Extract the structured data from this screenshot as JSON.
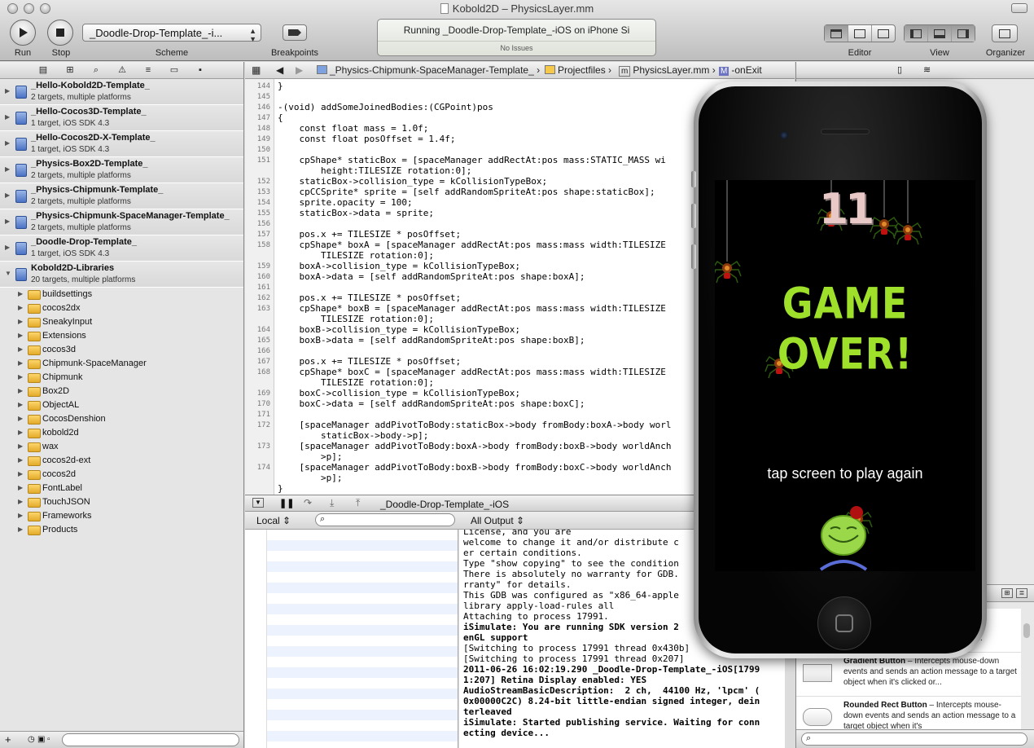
{
  "window": {
    "title": "Kobold2D – PhysicsLayer.mm"
  },
  "toolbar": {
    "run_label": "Run",
    "stop_label": "Stop",
    "scheme_value": "_Doodle-Drop-Template_-i...",
    "scheme_label": "Scheme",
    "breakpoints_label": "Breakpoints",
    "status_main": "Running _Doodle-Drop-Template_-iOS on iPhone Si",
    "status_sub": "No Issues",
    "editor_label": "Editor",
    "view_label": "View",
    "organizer_label": "Organizer"
  },
  "navigator": {
    "projects": [
      {
        "name": "_Hello-Kobold2D-Template_",
        "sub": "2 targets, multiple platforms"
      },
      {
        "name": "_Hello-Cocos3D-Template_",
        "sub": "1 target, iOS SDK 4.3"
      },
      {
        "name": "_Hello-Cocos2D-X-Template_",
        "sub": "1 target, iOS SDK 4.3"
      },
      {
        "name": "_Physics-Box2D-Template_",
        "sub": "2 targets, multiple platforms"
      },
      {
        "name": "_Physics-Chipmunk-Template_",
        "sub": "2 targets, multiple platforms"
      },
      {
        "name": "_Physics-Chipmunk-SpaceManager-Template_",
        "sub": "2 targets, multiple platforms"
      },
      {
        "name": "_Doodle-Drop-Template_",
        "sub": "1 target, iOS SDK 4.3"
      },
      {
        "name": "Kobold2D-Libraries",
        "sub": "20 targets, multiple platforms"
      }
    ],
    "groups": [
      "buildsettings",
      "cocos2dx",
      "SneakyInput",
      "Extensions",
      "cocos3d",
      "Chipmunk-SpaceManager",
      "Chipmunk",
      "Box2D",
      "ObjectAL",
      "CocosDenshion",
      "kobold2d",
      "wax",
      "cocos2d-ext",
      "cocos2d",
      "FontLabel",
      "TouchJSON",
      "Frameworks",
      "Products"
    ]
  },
  "jumpbar": {
    "project": "_Physics-Chipmunk-SpaceManager-Template_",
    "folder": "Projectfiles",
    "file": "PhysicsLayer.mm",
    "method": "-onExit",
    "method_badge": "M",
    "file_badge": "m"
  },
  "code": {
    "line_numbers": [
      "144",
      "145",
      "146",
      "147",
      "148",
      "149",
      "150",
      "151",
      "",
      "152",
      "153",
      "154",
      "155",
      "156",
      "157",
      "158",
      "",
      "159",
      "160",
      "161",
      "162",
      "163",
      "",
      "164",
      "165",
      "166",
      "167",
      "168",
      "",
      "169",
      "170",
      "171",
      "172",
      "",
      "173",
      "",
      "174",
      "",
      ""
    ],
    "lines": [
      "}",
      "",
      "-(void) addSomeJoinedBodies:(CGPoint)pos",
      "{",
      "    const float mass = 1.0f;",
      "    const float posOffset = 1.4f;",
      "",
      "    cpShape* staticBox = [spaceManager addRectAt:pos mass:STATIC_MASS wi",
      "        height:TILESIZE rotation:0];",
      "    staticBox->collision_type = kCollisionTypeBox;",
      "    cpCCSprite* sprite = [self addRandomSpriteAt:pos shape:staticBox];",
      "    sprite.opacity = 100;",
      "    staticBox->data = sprite;",
      "",
      "    pos.x += TILESIZE * posOffset;",
      "    cpShape* boxA = [spaceManager addRectAt:pos mass:mass width:TILESIZE",
      "        TILESIZE rotation:0];",
      "    boxA->collision_type = kCollisionTypeBox;",
      "    boxA->data = [self addRandomSpriteAt:pos shape:boxA];",
      "",
      "    pos.x += TILESIZE * posOffset;",
      "    cpShape* boxB = [spaceManager addRectAt:pos mass:mass width:TILESIZE",
      "        TILESIZE rotation:0];",
      "    boxB->collision_type = kCollisionTypeBox;",
      "    boxB->data = [self addRandomSpriteAt:pos shape:boxB];",
      "",
      "    pos.x += TILESIZE * posOffset;",
      "    cpShape* boxC = [spaceManager addRectAt:pos mass:mass width:TILESIZE",
      "        TILESIZE rotation:0];",
      "    boxC->collision_type = kCollisionTypeBox;",
      "    boxC->data = [self addRandomSpriteAt:pos shape:boxC];",
      "",
      "    [spaceManager addPivotToBody:staticBox->body fromBody:boxA->body worl",
      "        staticBox->body->p];",
      "    [spaceManager addPivotToBody:boxA->body fromBody:boxB->body worldAnch",
      "        >p];",
      "    [spaceManager addPivotToBody:boxB->body fromBody:boxC->body worldAnch",
      "        >p];",
      "}"
    ]
  },
  "debug": {
    "target_label": "_Doodle-Drop-Template_-iOS",
    "local_label": "Local",
    "all_output_label": "All Output",
    "console_lines": [
      {
        "t": "License, and you are",
        "b": false
      },
      {
        "t": "welcome to change it and/or distribute c",
        "b": false
      },
      {
        "t": "er certain conditions.",
        "b": false
      },
      {
        "t": "Type \"show copying\" to see the condition",
        "b": false
      },
      {
        "t": "There is absolutely no warranty for GDB.",
        "b": false
      },
      {
        "t": "rranty\" for details.",
        "b": false
      },
      {
        "t": "This GDB was configured as \"x86_64-apple",
        "b": false
      },
      {
        "t": "library apply-load-rules all",
        "b": false
      },
      {
        "t": "Attaching to process 17991.",
        "b": false
      },
      {
        "t": "iSimulate: You are running SDK version 2",
        "b": true
      },
      {
        "t": "enGL support",
        "b": true
      },
      {
        "t": "[Switching to process 17991 thread 0x430b]",
        "b": false
      },
      {
        "t": "[Switching to process 17991 thread 0x207]",
        "b": false
      },
      {
        "t": "2011-06-26 16:02:19.290 _Doodle-Drop-Template_-iOS[1799",
        "b": true
      },
      {
        "t": "1:207] Retina Display enabled: YES",
        "b": true
      },
      {
        "t": "AudioStreamBasicDescription:  2 ch,  44100 Hz, 'lpcm' (",
        "b": true
      },
      {
        "t": "0x00000C2C) 8.24-bit little-endian signed integer, dein",
        "b": true
      },
      {
        "t": "terleaved",
        "b": true
      },
      {
        "t": "iSimulate: Started publishing service. Waiting for conn",
        "b": true
      },
      {
        "t": "ecting device...",
        "b": true
      }
    ]
  },
  "library": {
    "items": [
      {
        "title": "",
        "desc": "own\ne to a\nressed."
      },
      {
        "title": "Gradient Button",
        "desc": " – Intercepts mouse-down events and sends an action message to a target object when it's clicked or..."
      },
      {
        "title": "Rounded Rect Button",
        "desc": " – Intercepts mouse-down events and sends an action message to a target object when it's"
      }
    ]
  },
  "game": {
    "score": "11",
    "game_over": "GAME OVER!",
    "tap_text": "tap screen to play again",
    "colors": {
      "game_over": "#9ee02a",
      "score": "#e9c8c8"
    }
  }
}
